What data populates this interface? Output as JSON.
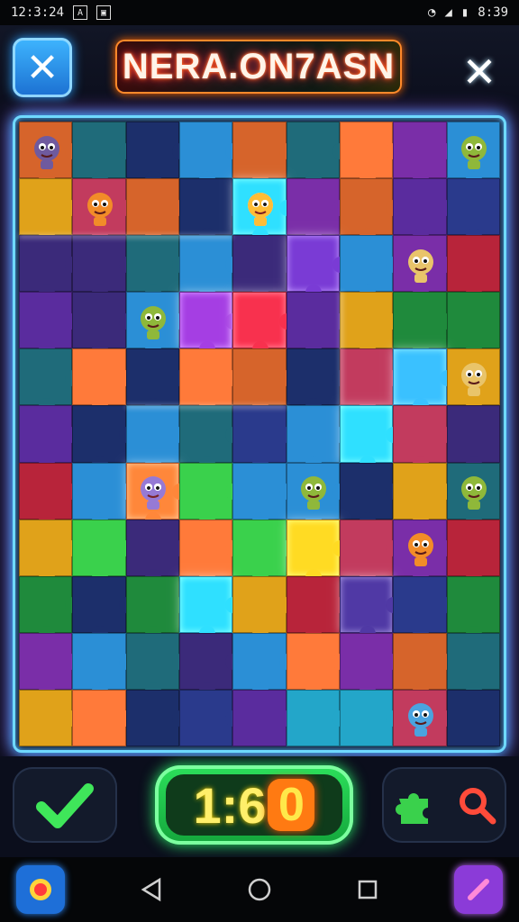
{
  "status_bar": {
    "time": "12:3:24",
    "right_text": "8:39",
    "icons": [
      "notification-a-icon",
      "image-icon",
      "wifi-icon",
      "signal-icon",
      "battery-icon"
    ]
  },
  "header": {
    "title": "NERA.ON7ASN",
    "close_left_icon": "close-icon",
    "close_right_icon": "close-icon"
  },
  "board": {
    "rows": 11,
    "cols": 9,
    "colors": [
      "#2a3a8c",
      "#1f6b7a",
      "#5a2c9e",
      "#1c2f6b",
      "#b8243a",
      "#1f8a3c",
      "#2b8fd6",
      "#d6642b",
      "#7a2ea8",
      "#c23b5e",
      "#23a6c9",
      "#e0a21a",
      "#3ad14c",
      "#ff7a3a",
      "#3b2a7a"
    ],
    "accent_glow": "#6fd9ff"
  },
  "controls": {
    "confirm_icon": "checkmark-icon",
    "timer": {
      "main": "1:6",
      "last": "0"
    },
    "tools": [
      "puzzle-piece-icon",
      "search-icon"
    ]
  },
  "navbar": {
    "left_app_icon": "record-app-icon",
    "back_icon": "back-icon",
    "home_icon": "home-icon",
    "recents_icon": "recents-icon",
    "right_app_icon": "phone-app-icon"
  }
}
